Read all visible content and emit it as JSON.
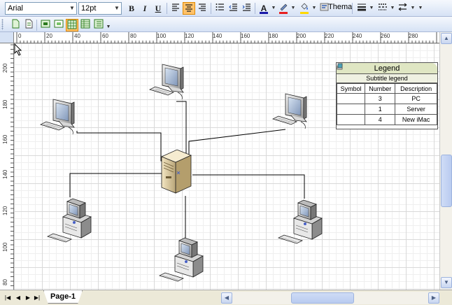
{
  "toolbar": {
    "font_name": "Arial",
    "font_size": "12pt",
    "bold_label": "B",
    "italic_label": "I",
    "underline_label": "U",
    "thema_label": "Thema",
    "font_color_glyph": "A"
  },
  "ruler": {
    "top_ticks": [
      "0",
      "20",
      "40",
      "60",
      "80",
      "100",
      "120",
      "140",
      "160",
      "180",
      "200",
      "220",
      "240",
      "260",
      "280"
    ],
    "left_ticks": [
      "200",
      "180",
      "160",
      "140",
      "120",
      "100",
      "80"
    ]
  },
  "legend": {
    "title": "Legend",
    "subtitle": "Subtitle legend",
    "headers": [
      "Symbol",
      "Number",
      "Description"
    ],
    "rows": [
      {
        "symbol": "pc-icon",
        "number": "3",
        "description": "PC"
      },
      {
        "symbol": "server-icon",
        "number": "1",
        "description": "Server"
      },
      {
        "symbol": "imac-icon",
        "number": "4",
        "description": "New iMac"
      }
    ]
  },
  "page_tabs": {
    "active": "Page-1"
  },
  "colors": {
    "toolbar_bg": "#d6e2f5",
    "active_button": "#ffc26a",
    "legend_title_bg": "#dfe6c3",
    "font_color_bar": "#1a1aa8",
    "highlight_bar": "#e82020",
    "fill_color_bar": "#ffd800"
  },
  "diagram": {
    "shapes": [
      "imac",
      "imac",
      "imac",
      "imac",
      "server",
      "pc",
      "pc",
      "pc"
    ]
  }
}
